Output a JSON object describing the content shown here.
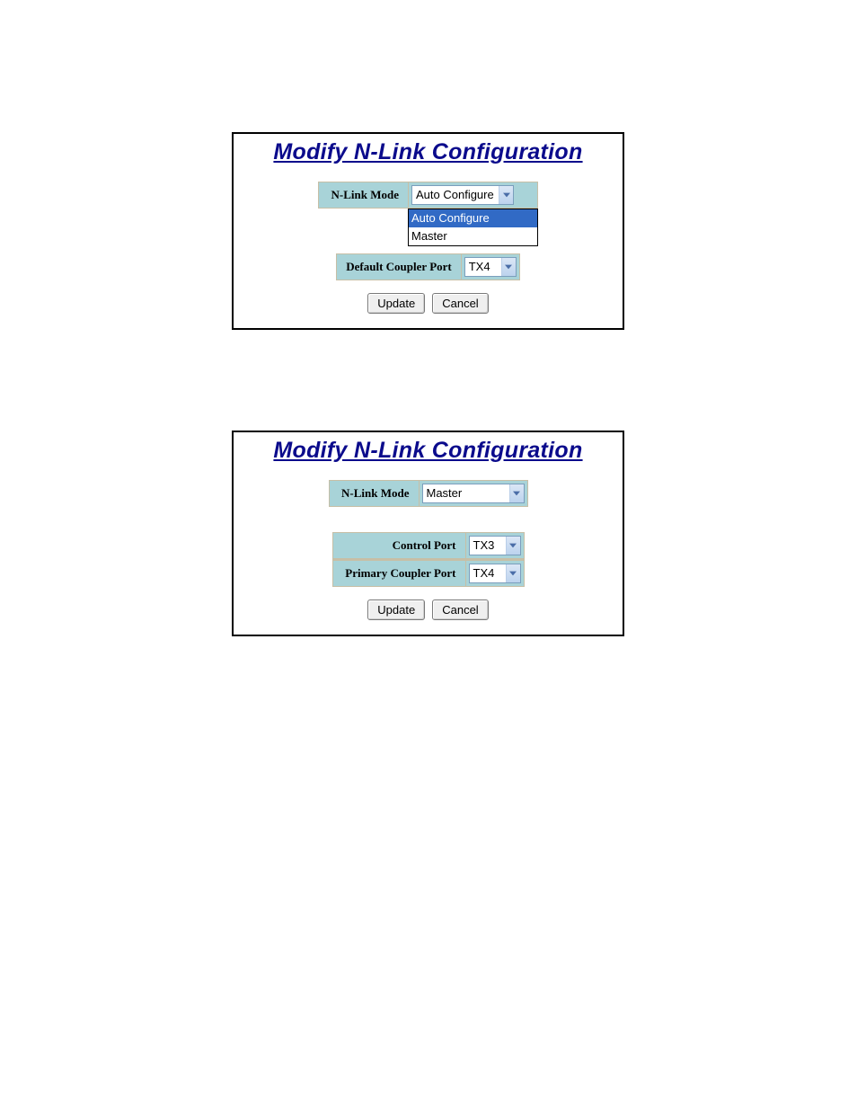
{
  "panel1": {
    "title": "Modify N-Link Configuration",
    "nlink_mode_label": "N-Link Mode",
    "nlink_mode_value": "Auto Configure",
    "nlink_mode_options": {
      "opt0": "Auto Configure",
      "opt1": "Master"
    },
    "default_coupler_label": "Default Coupler Port",
    "default_coupler_value": "TX4",
    "update_label": "Update",
    "cancel_label": "Cancel"
  },
  "panel2": {
    "title": "Modify N-Link Configuration",
    "nlink_mode_label": "N-Link Mode",
    "nlink_mode_value": "Master",
    "control_port_label": "Control Port",
    "control_port_value": "TX3",
    "primary_coupler_label": "Primary Coupler Port",
    "primary_coupler_value": "TX4",
    "update_label": "Update",
    "cancel_label": "Cancel"
  }
}
